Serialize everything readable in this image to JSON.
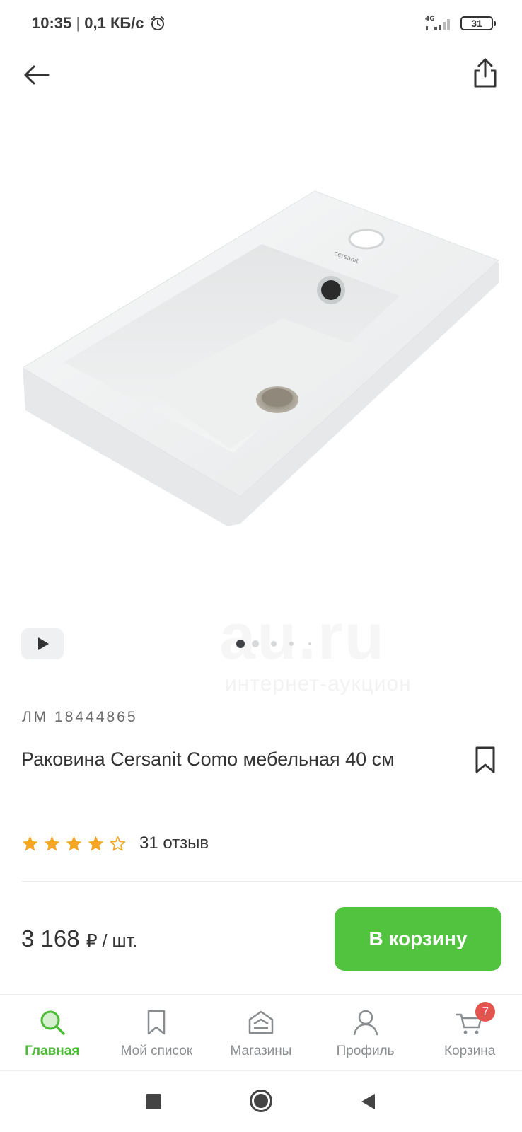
{
  "status_bar": {
    "time": "10:35",
    "separator": "|",
    "network_speed": "0,1 КБ/с",
    "network_type": "4G",
    "battery": "31"
  },
  "icons": {
    "back": "arrow-left-icon",
    "share": "share-icon",
    "play": "play-icon",
    "bookmark": "bookmark-icon",
    "alarm": "alarm-clock-icon",
    "signal": "signal-icon"
  },
  "gallery": {
    "slide_count": 4,
    "active_slide": 1,
    "watermark_main": "au.ru",
    "watermark_sub": "интернет-аукцион",
    "product_brand_mark": "cersanit"
  },
  "product": {
    "sku": "ЛМ 18444865",
    "title": "Раковина Cersanit Como мебельная 40 см",
    "rating": 4,
    "rating_max": 5,
    "reviews": "31 отзыв",
    "price_value": "3 168",
    "price_unit": "₽ / шт.",
    "cart_button": "В корзину"
  },
  "colors": {
    "accent_green": "#51c33f",
    "star": "#f5a623",
    "badge": "#e2554f"
  },
  "bottom_nav": {
    "items": [
      {
        "label": "Главная",
        "icon": "search-icon",
        "active": true
      },
      {
        "label": "Мой список",
        "icon": "bookmark-icon",
        "active": false
      },
      {
        "label": "Магазины",
        "icon": "store-icon",
        "active": false
      },
      {
        "label": "Профиль",
        "icon": "profile-icon",
        "active": false
      },
      {
        "label": "Корзина",
        "icon": "cart-icon",
        "active": false,
        "badge": "7"
      }
    ]
  }
}
